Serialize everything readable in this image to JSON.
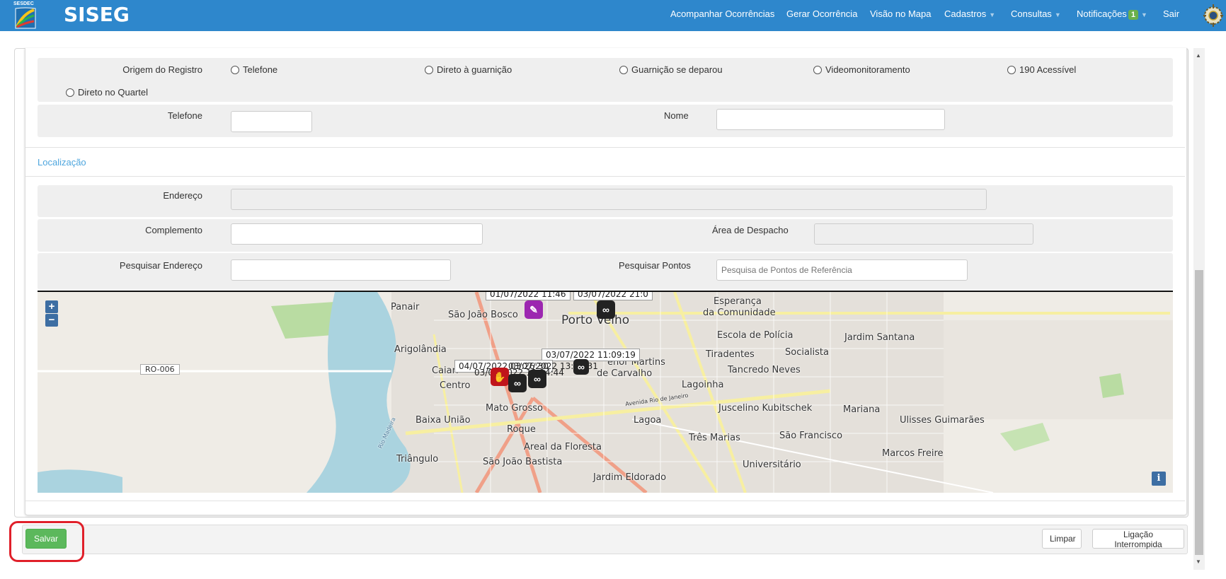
{
  "navbar": {
    "brand_title": "SISEG",
    "logo_text": "SESDEC",
    "items": [
      {
        "label": "Acompanhar Ocorrências"
      },
      {
        "label": "Gerar Ocorrência"
      },
      {
        "label": "Visão no Mapa"
      },
      {
        "label": "Cadastros"
      },
      {
        "label": "Consultas"
      },
      {
        "label": "Notificações"
      },
      {
        "label": "Sair"
      }
    ],
    "notifications_count": "1"
  },
  "form": {
    "origin_label": "Origem do Registro",
    "origin_options": [
      {
        "label": "Telefone"
      },
      {
        "label": "Direto à guarnição"
      },
      {
        "label": "Guarnição se deparou"
      },
      {
        "label": "Videomonitoramento"
      },
      {
        "label": "190 Acessível"
      },
      {
        "label": "Direto no Quartel"
      }
    ],
    "phone_label": "Telefone",
    "phone_value": "",
    "name_label": "Nome",
    "name_value": ""
  },
  "location": {
    "heading": "Localização",
    "address_label": "Endereço",
    "address_value": "",
    "complement_label": "Complemento",
    "complement_value": "",
    "dispatch_area_label": "Área de Despacho",
    "dispatch_area_value": "",
    "search_address_label": "Pesquisar Endereço",
    "search_address_value": "",
    "search_points_label": "Pesquisar Pontos",
    "search_points_placeholder": "Pesquisa de Pontos de Referência"
  },
  "map": {
    "place_labels": [
      "Panair",
      "São João Bosco",
      "Porto Velho",
      "Esperança",
      "da Comunidade",
      "Escola de Polícia",
      "Jardim Santana",
      "Arigolândia",
      "Tiradentes",
      "Socialista",
      "Caiari",
      "enor Martins",
      "de Carvalho",
      "Tancredo Neves",
      "Centro",
      "Lagoinha",
      "Mato Grosso",
      "Juscelino Kubitschek",
      "Mariana",
      "Baixa União",
      "Lagoa",
      "Ulisses Guimarães",
      "Roque",
      "Três Marias",
      "São Francisco",
      "Areal da Floresta",
      "Marcos Freire",
      "Triângulo",
      "São João Bastista",
      "Universitário",
      "Jardim Eldorado",
      "RO-006",
      "Avenida Rio de Janeiro",
      "Rio Madeira"
    ],
    "tooltips": [
      "01/07/2022 11:46",
      "03/07/2022 21:0",
      "03/07/2022 11:09:19",
      "04/07/2022 03:26:30",
      "03/07/2022 13:19:31",
      "03/07/2022 12:14:44"
    ],
    "marker_icons": [
      "syringe-marker-icon",
      "mask-marker-icon",
      "mask-marker-icon",
      "mask-marker-icon",
      "robbery-marker-icon",
      "hand-marker-icon"
    ],
    "zoom_in": "+",
    "zoom_out": "−",
    "info": "i"
  },
  "footer": {
    "save_label": "Salvar",
    "clear_label": "Limpar",
    "interrupted_label": "Ligação Interrompida"
  },
  "colors": {
    "navbar": "#2e87cc",
    "save_button": "#5cb85c",
    "highlight": "#e0202a",
    "link": "#4ea6de"
  }
}
